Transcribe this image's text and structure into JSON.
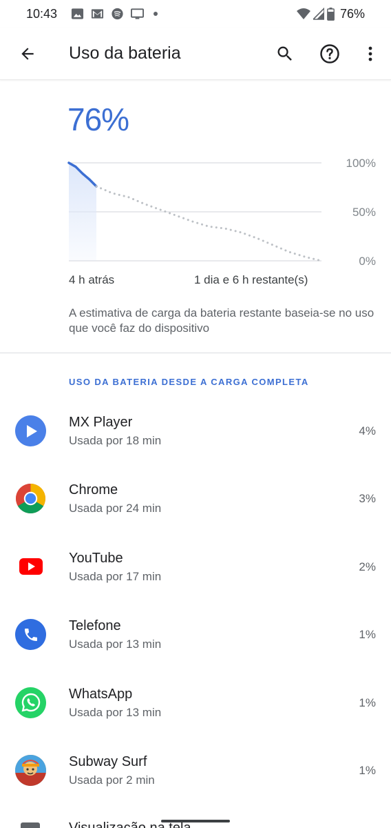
{
  "status_bar": {
    "time": "10:43",
    "battery_text": "76%",
    "left_icons": [
      "gallery-icon",
      "gmail-icon",
      "spotify-icon",
      "cast-icon"
    ],
    "right_icons": [
      "wifi-icon",
      "signal-icon",
      "battery-icon"
    ]
  },
  "app_bar": {
    "title": "Uso da bateria",
    "icons": [
      "back-arrow-icon",
      "search-icon",
      "help-icon",
      "more-vert-icon"
    ]
  },
  "battery": {
    "level_text": "76%",
    "level_fraction": 0.76
  },
  "chart_data": {
    "type": "line",
    "y_tick_labels": [
      "100%",
      "50%",
      "0%"
    ],
    "ylim": [
      0,
      100
    ],
    "x_labels": [
      "4 h atrás",
      "1 dia e 6 h restante(s)"
    ],
    "series": [
      {
        "values": [
          100,
          96,
          89,
          83,
          76
        ]
      },
      {
        "values": [
          76,
          69,
          65,
          58,
          52,
          46,
          40,
          35,
          33,
          29,
          23,
          16,
          9,
          4,
          0
        ]
      }
    ],
    "colors": {
      "actual": "#3c6fd3",
      "projection": "#bdc1c6",
      "grid": "#dadce0",
      "fill": "#dde7fa"
    }
  },
  "estimate_note": "A estimativa de carga da bateria restante baseia-se no uso que você faz do dispositivo",
  "section_header": "USO DA BATERIA DESDE A CARGA COMPLETA",
  "apps": [
    {
      "name": "MX Player",
      "usage": "Usada por 18 min",
      "percent": "4%",
      "icon": "mx-player-icon"
    },
    {
      "name": "Chrome",
      "usage": "Usada por 24 min",
      "percent": "3%",
      "icon": "chrome-icon"
    },
    {
      "name": "YouTube",
      "usage": "Usada por 17 min",
      "percent": "2%",
      "icon": "youtube-icon"
    },
    {
      "name": "Telefone",
      "usage": "Usada por 13 min",
      "percent": "1%",
      "icon": "phone-icon"
    },
    {
      "name": "WhatsApp",
      "usage": "Usada por 13 min",
      "percent": "1%",
      "icon": "whatsapp-icon"
    },
    {
      "name": "Subway Surf",
      "usage": "Usada por 2 min",
      "percent": "1%",
      "icon": "subway-surf-icon"
    }
  ],
  "partial_item": {
    "name": "Visualização na tela",
    "icon": "screen-icon"
  },
  "colors": {
    "accent": "#3c6fd3"
  }
}
